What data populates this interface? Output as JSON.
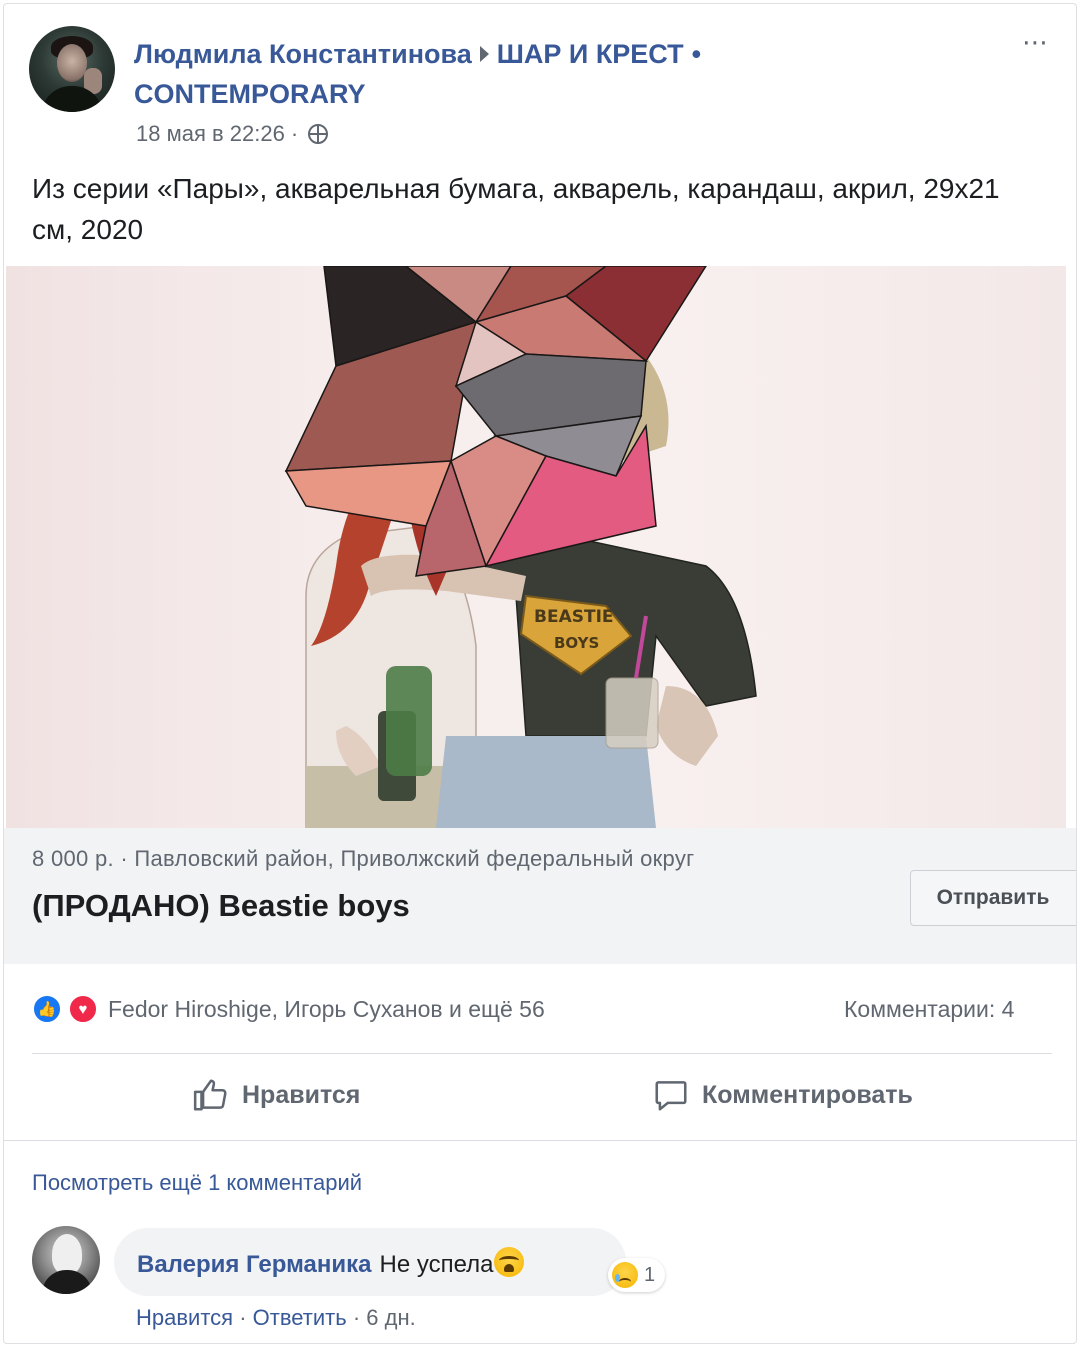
{
  "post": {
    "author": "Людмила Константинова",
    "group": "ШАР И КРЕСТ",
    "group_suffix": "CONTEMPORARY",
    "bullet": "•",
    "time": "18 мая в 22:26 ·",
    "text": "Из серии «Пары», акварельная бумага, акварель, карандаш, акрил, 29х21 см, 2020",
    "more_icon": "⋯",
    "privacy_icon": "globe-icon"
  },
  "artwork": {
    "shirt_text_1": "BEASTIE",
    "shirt_text_2": "BOYS"
  },
  "product": {
    "price_location": "8 000 р. · Павловский район, Приволжский федеральный округ",
    "title": "(ПРОДАНО) Beastie boys",
    "send_label": "Отправить"
  },
  "reactions": {
    "names": "Fedor Hiroshige, Игорь Суханов и ещё 56",
    "comments_count": "Комментарии: 4",
    "like_icon": "👍",
    "love_icon": "♥"
  },
  "actions": {
    "like_label": "Нравится",
    "comment_label": "Комментировать"
  },
  "comments": {
    "view_more": "Посмотреть ещё 1 комментарий",
    "items": [
      {
        "author": "Валерия Германика",
        "text": "Не успела",
        "reaction_count": "1",
        "like_label": "Нравится",
        "reply_label": "Ответить",
        "age": "6 дн.",
        "sep": "·"
      }
    ]
  },
  "colors": {
    "link": "#385898",
    "secondary": "#606770",
    "like_blue": "#1877f2",
    "love_red": "#f0284a"
  }
}
